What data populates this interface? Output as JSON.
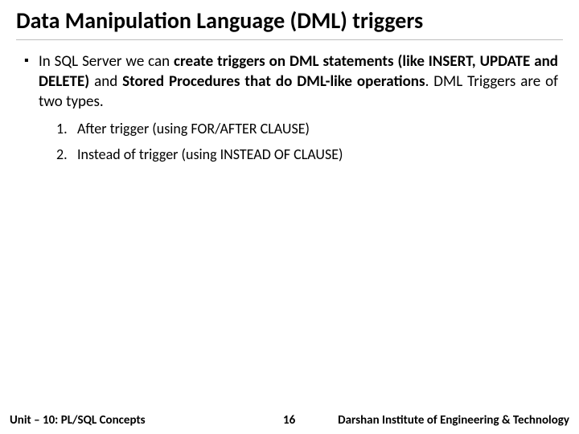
{
  "title": "Data Manipulation Language (DML) triggers",
  "bullet": {
    "pre": "In SQL Server we can ",
    "bold1": "create triggers on DML statements (like INSERT, UPDATE and DELETE)",
    "mid": " and ",
    "bold2": "Stored Procedures that do DML-like operations",
    "post": ". DML Triggers are of two types."
  },
  "items": [
    {
      "n": "1.",
      "text": "After trigger (using FOR/AFTER CLAUSE)"
    },
    {
      "n": "2.",
      "text": "Instead of trigger (using INSTEAD OF CLAUSE)"
    }
  ],
  "footer": {
    "unit": "Unit – 10: PL/SQL Concepts",
    "page": "16",
    "institute": "Darshan Institute of Engineering & Technology"
  }
}
